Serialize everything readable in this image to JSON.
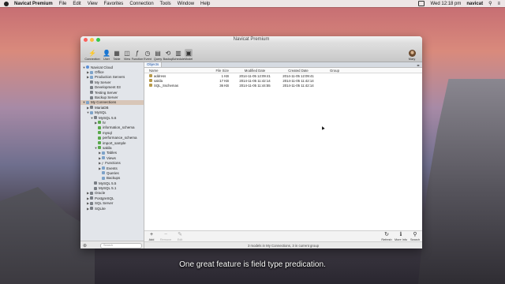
{
  "menubar": {
    "app": "Navicat Premium",
    "items": [
      "File",
      "Edit",
      "View",
      "Favorites",
      "Connection",
      "Tools",
      "Window",
      "Help"
    ],
    "clock": "Wed 12:18 pm",
    "user": "navicat"
  },
  "window": {
    "title": "Navicat Premium"
  },
  "toolbar": {
    "items": [
      {
        "label": "Connection",
        "icon": "plug-icon",
        "glyph": "⚡"
      },
      {
        "label": "User",
        "icon": "user-icon",
        "glyph": "👤"
      },
      {
        "label": "Table",
        "icon": "table-icon",
        "glyph": "▦"
      },
      {
        "label": "View",
        "icon": "view-icon",
        "glyph": "◫"
      },
      {
        "label": "Function",
        "icon": "function-icon",
        "glyph": "ƒ"
      },
      {
        "label": "Event",
        "icon": "clock-icon",
        "glyph": "◷"
      },
      {
        "label": "Query",
        "icon": "query-icon",
        "glyph": "▤"
      },
      {
        "label": "Backup",
        "icon": "backup-icon",
        "glyph": "⟲"
      },
      {
        "label": "Schedule",
        "icon": "calendar-icon",
        "glyph": "▥"
      },
      {
        "label": "Model",
        "icon": "model-icon",
        "glyph": "▣"
      }
    ],
    "user_label": "Mary"
  },
  "sidebar": {
    "tree": [
      {
        "label": "Navicat Cloud",
        "depth": 0,
        "tw": "▼",
        "icon": "cloud"
      },
      {
        "label": "Office",
        "depth": 1,
        "tw": "▶",
        "icon": "folder"
      },
      {
        "label": "Production Servers",
        "depth": 1,
        "tw": "▶",
        "icon": "folder"
      },
      {
        "label": "My Server",
        "depth": 1,
        "tw": "",
        "icon": "server"
      },
      {
        "label": "Development 03",
        "depth": 1,
        "tw": "",
        "icon": "server"
      },
      {
        "label": "Testing Server",
        "depth": 1,
        "tw": "",
        "icon": "server"
      },
      {
        "label": "Backup Server",
        "depth": 1,
        "tw": "",
        "icon": "server"
      },
      {
        "label": "My Connections",
        "depth": 0,
        "tw": "▼",
        "icon": "folder",
        "selected": true
      },
      {
        "label": "MariaDB",
        "depth": 1,
        "tw": "▶",
        "icon": "server"
      },
      {
        "label": "MySQL",
        "depth": 1,
        "tw": "▼",
        "icon": "folder"
      },
      {
        "label": "MySQL 5.6",
        "depth": 2,
        "tw": "▼",
        "icon": "server"
      },
      {
        "label": "hr",
        "depth": 3,
        "tw": "▶",
        "icon": "db"
      },
      {
        "label": "information_schema",
        "depth": 3,
        "tw": "",
        "icon": "db"
      },
      {
        "label": "mysql",
        "depth": 3,
        "tw": "",
        "icon": "db"
      },
      {
        "label": "performance_schema",
        "depth": 3,
        "tw": "",
        "icon": "db"
      },
      {
        "label": "import_sample",
        "depth": 3,
        "tw": "",
        "icon": "db"
      },
      {
        "label": "sakila",
        "depth": 3,
        "tw": "▼",
        "icon": "db"
      },
      {
        "label": "Tables",
        "depth": 4,
        "tw": "▶",
        "icon": "folder"
      },
      {
        "label": "Views",
        "depth": 4,
        "tw": "▶",
        "icon": "folder"
      },
      {
        "label": "Functions",
        "depth": 4,
        "tw": "▶",
        "icon": "fn"
      },
      {
        "label": "Events",
        "depth": 4,
        "tw": "▶",
        "icon": "folder"
      },
      {
        "label": "Queries",
        "depth": 4,
        "tw": "",
        "icon": "folder"
      },
      {
        "label": "Backups",
        "depth": 4,
        "tw": "",
        "icon": "folder"
      },
      {
        "label": "MySQL 5.5",
        "depth": 2,
        "tw": "",
        "icon": "server"
      },
      {
        "label": "MySQL 5.1",
        "depth": 2,
        "tw": "",
        "icon": "server"
      },
      {
        "label": "Oracle",
        "depth": 1,
        "tw": "▶",
        "icon": "server"
      },
      {
        "label": "PostgreSQL",
        "depth": 1,
        "tw": "▶",
        "icon": "server"
      },
      {
        "label": "SQL Server",
        "depth": 1,
        "tw": "▶",
        "icon": "server"
      },
      {
        "label": "SQLite",
        "depth": 1,
        "tw": "▶",
        "icon": "server"
      }
    ],
    "search_placeholder": "Search"
  },
  "content": {
    "tab": "Objects",
    "columns": [
      "Name",
      "File Size",
      "Modified Date",
      "Created Date",
      "Group"
    ],
    "rows": [
      {
        "name": "address",
        "size": "1 KB",
        "modified": "2014-11-05 12:09:41",
        "created": "2014-11-05 12:09:41",
        "group": ""
      },
      {
        "name": "sakila",
        "size": "17 KB",
        "modified": "2014-11-05 11:42:14",
        "created": "2014-11-05 11:42:14",
        "group": ""
      },
      {
        "name": "SQL_Sschemas",
        "size": "36 KB",
        "modified": "2014-11-05 11:44:55",
        "created": "2014-11-05 11:42:14",
        "group": ""
      }
    ]
  },
  "bottombar": {
    "left": [
      {
        "label": "Add",
        "glyph": "+",
        "icon": "add-icon",
        "disabled": false
      },
      {
        "label": "Remove",
        "glyph": "−",
        "icon": "remove-icon",
        "disabled": true
      },
      {
        "label": "Edit",
        "glyph": "✎",
        "icon": "edit-icon",
        "disabled": true
      }
    ],
    "right": [
      {
        "label": "Refresh",
        "glyph": "↻",
        "icon": "refresh-icon"
      },
      {
        "label": "More Info",
        "glyph": "ℹ",
        "icon": "info-icon"
      },
      {
        "label": "Search",
        "glyph": "⚲",
        "icon": "search-icon"
      }
    ]
  },
  "status": "3 models in My Connections, 3 in current group",
  "caption": "One great feature is field type predication."
}
